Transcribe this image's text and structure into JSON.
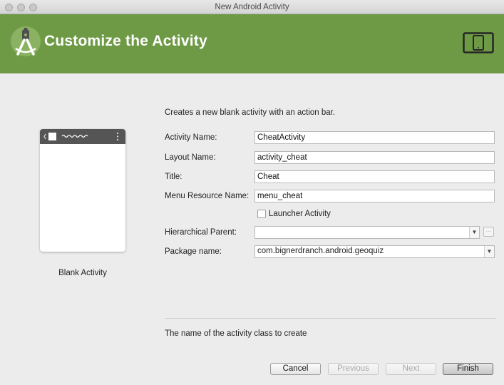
{
  "window": {
    "title": "New Android Activity"
  },
  "header": {
    "title": "Customize the Activity",
    "logo_icon": "android-studio-icon",
    "device_icon": "phone-tablet-icon",
    "accent": "#6e9a46"
  },
  "template": {
    "caption": "Blank Activity",
    "description": "Creates a new blank activity with an action bar."
  },
  "form": {
    "activity_name": {
      "label": "Activity Name:",
      "value": "CheatActivity"
    },
    "layout_name": {
      "label": "Layout Name:",
      "value": "activity_cheat"
    },
    "title": {
      "label": "Title:",
      "value": "Cheat"
    },
    "menu_resource": {
      "label": "Menu Resource Name:",
      "value": "menu_cheat"
    },
    "launcher": {
      "label": "Launcher Activity",
      "checked": false
    },
    "hierarchical_parent": {
      "label": "Hierarchical Parent:",
      "value": ""
    },
    "package_name": {
      "label": "Package name:",
      "value": "com.bignerdranch.android.geoquiz"
    }
  },
  "help_text": "The name of the activity class to create",
  "buttons": {
    "cancel": "Cancel",
    "previous": "Previous",
    "next": "Next",
    "finish": "Finish"
  }
}
